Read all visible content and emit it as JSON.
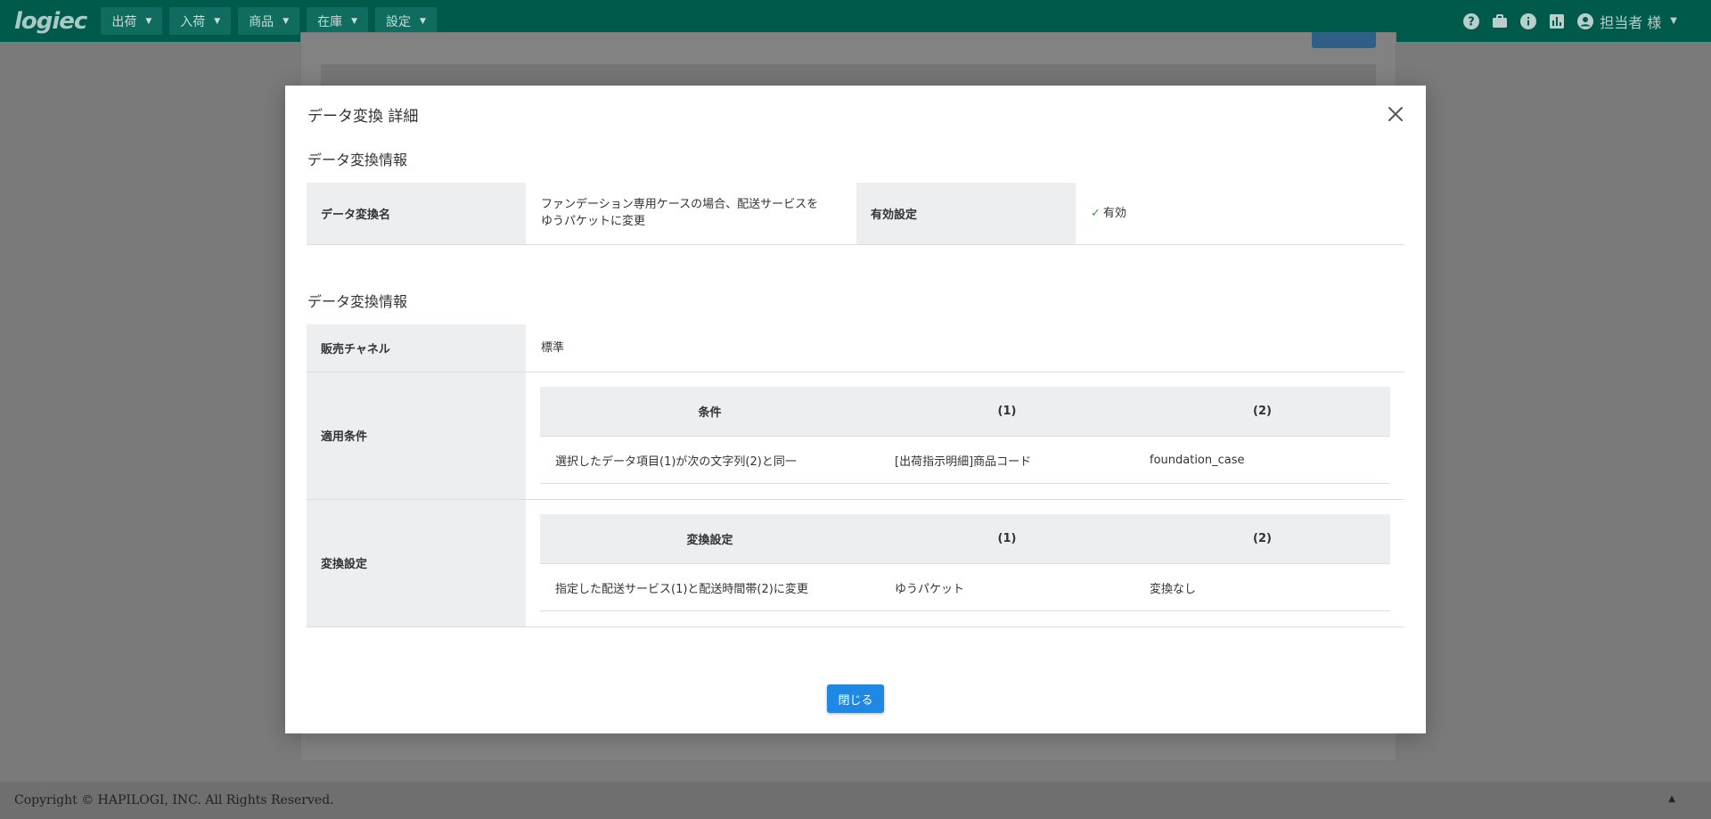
{
  "header": {
    "logo": "logiec",
    "nav": [
      {
        "label": "出荷"
      },
      {
        "label": "入荷"
      },
      {
        "label": "商品"
      },
      {
        "label": "在庫"
      },
      {
        "label": "設定"
      }
    ],
    "user_name": "担当者 様"
  },
  "footer": {
    "copyright": "Copyright © HAPILOGI, INC. All Rights Reserved."
  },
  "modal": {
    "title": "データ変換 詳細",
    "section1": {
      "title": "データ変換情報",
      "name_label": "データ変換名",
      "name_value": "ファンデーション専用ケースの場合、配送サービスを\nゆうパケットに変更",
      "enabled_label": "有効設定",
      "enabled_value": "有効"
    },
    "section2": {
      "title": "データ変換情報",
      "channel_label": "販売チャネル",
      "channel_value": "標準",
      "condition_label": "適用条件",
      "condition_table": {
        "headers": [
          "条件",
          "(1)",
          "(2)"
        ],
        "row": [
          "選択したデータ項目(1)が次の文字列(2)と同一",
          "[出荷指示明細]商品コード",
          "foundation_case"
        ]
      },
      "conversion_label": "変換設定",
      "conversion_table": {
        "headers": [
          "変換設定",
          "(1)",
          "(2)"
        ],
        "row": [
          "指定した配送サービス(1)と配送時間帯(2)に変更",
          "ゆうパケット",
          "変換なし"
        ]
      }
    },
    "close_button": "閉じる"
  }
}
